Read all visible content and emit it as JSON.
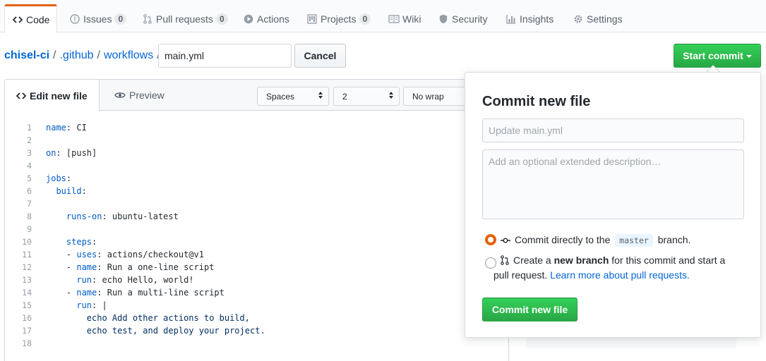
{
  "reponav": {
    "tabs": [
      {
        "label": "Code",
        "icon": "code-icon"
      },
      {
        "label": "Issues",
        "icon": "issue-icon",
        "count": "0"
      },
      {
        "label": "Pull requests",
        "icon": "pull-request-icon",
        "count": "0"
      },
      {
        "label": "Actions",
        "icon": "play-icon"
      },
      {
        "label": "Projects",
        "icon": "project-icon",
        "count": "0"
      },
      {
        "label": "Wiki",
        "icon": "book-icon"
      },
      {
        "label": "Security",
        "icon": "shield-icon"
      },
      {
        "label": "Insights",
        "icon": "graph-icon"
      },
      {
        "label": "Settings",
        "icon": "gear-icon"
      }
    ]
  },
  "breadcrumb": {
    "repo": "chisel-ci",
    "sep": "/",
    "dir1": ".github",
    "dir2": "workflows",
    "filename_value": "main.yml"
  },
  "actions": {
    "cancel": "Cancel",
    "start_commit": "Start commit"
  },
  "editor": {
    "tab_edit": "Edit new file",
    "tab_preview": "Preview",
    "indent_mode": "Spaces",
    "indent_size": "2",
    "wrap_mode": "No wrap",
    "lines": [
      [
        {
          "t": "name",
          "c": "k"
        },
        {
          "t": ": CI",
          "c": ""
        }
      ],
      [],
      [
        {
          "t": "on",
          "c": "k"
        },
        {
          "t": ": [push]",
          "c": ""
        }
      ],
      [],
      [
        {
          "t": "jobs",
          "c": "k"
        },
        {
          "t": ":",
          "c": ""
        }
      ],
      [
        {
          "t": "  ",
          "c": ""
        },
        {
          "t": "build",
          "c": "k"
        },
        {
          "t": ":",
          "c": ""
        }
      ],
      [],
      [
        {
          "t": "    ",
          "c": ""
        },
        {
          "t": "runs-on",
          "c": "k"
        },
        {
          "t": ": ubuntu-latest",
          "c": ""
        }
      ],
      [],
      [
        {
          "t": "    ",
          "c": ""
        },
        {
          "t": "steps",
          "c": "k"
        },
        {
          "t": ":",
          "c": ""
        }
      ],
      [
        {
          "t": "    - ",
          "c": ""
        },
        {
          "t": "uses",
          "c": "k"
        },
        {
          "t": ": actions/checkout@v1",
          "c": ""
        }
      ],
      [
        {
          "t": "    - ",
          "c": ""
        },
        {
          "t": "name",
          "c": "k"
        },
        {
          "t": ": Run a one-line script",
          "c": ""
        }
      ],
      [
        {
          "t": "      ",
          "c": ""
        },
        {
          "t": "run",
          "c": "k"
        },
        {
          "t": ": echo Hello, world!",
          "c": ""
        }
      ],
      [
        {
          "t": "    - ",
          "c": ""
        },
        {
          "t": "name",
          "c": "k"
        },
        {
          "t": ": Run a multi-line script",
          "c": ""
        }
      ],
      [
        {
          "t": "      ",
          "c": ""
        },
        {
          "t": "run",
          "c": "k"
        },
        {
          "t": ": |",
          "c": ""
        }
      ],
      [
        {
          "t": "        echo Add other actions to build,",
          "c": "s"
        }
      ],
      [
        {
          "t": "        echo test, and deploy your project.",
          "c": "s"
        }
      ],
      []
    ]
  },
  "commit": {
    "title": "Commit new file",
    "summary_placeholder": "Update main.yml",
    "description_placeholder": "Add an optional extended description…",
    "option1_prefix": "Commit directly to the",
    "option1_branch": "master",
    "option1_suffix": "branch.",
    "option2_prefix": "Create a",
    "option2_bold": "new branch",
    "option2_mid": "for this commit and start a pull request.",
    "option2_link": "Learn more about pull requests.",
    "submit": "Commit new file"
  },
  "colors": {
    "accent_tab": "#e36209",
    "link": "#0366d6",
    "primary_green": "#28a745",
    "yaml_key": "#005cc5"
  }
}
